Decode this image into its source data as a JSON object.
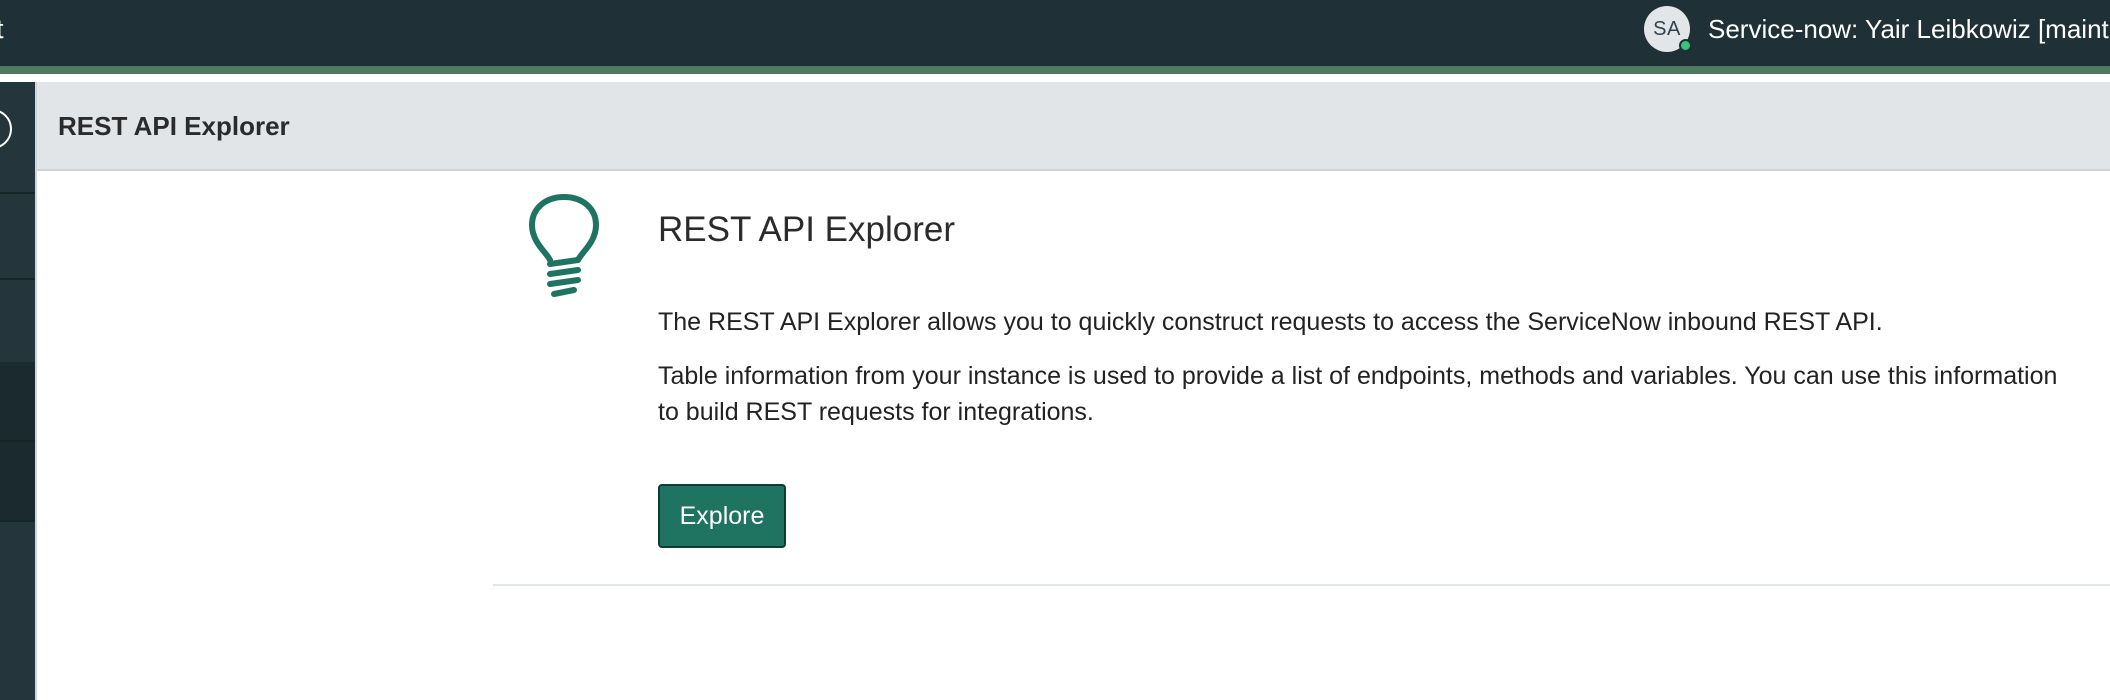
{
  "topbar": {
    "cut_text": "t",
    "avatar_initials": "SA",
    "user_label": "Service-now: Yair Leibkowiz [maint,ad"
  },
  "page_header": {
    "title": "REST API Explorer"
  },
  "content": {
    "icon": "lightbulb-icon",
    "title": "REST API Explorer",
    "paragraph_1": "The REST API Explorer allows you to quickly construct requests to access the ServiceNow inbound REST API.",
    "paragraph_2": "Table information from your instance is used to provide a list of endpoints, methods and variables. You can use this information to build REST requests for integrations.",
    "explore_label": "Explore"
  },
  "colors": {
    "topbar": "#1f3036",
    "accent": "#1f7461",
    "presence": "#36c57a"
  }
}
